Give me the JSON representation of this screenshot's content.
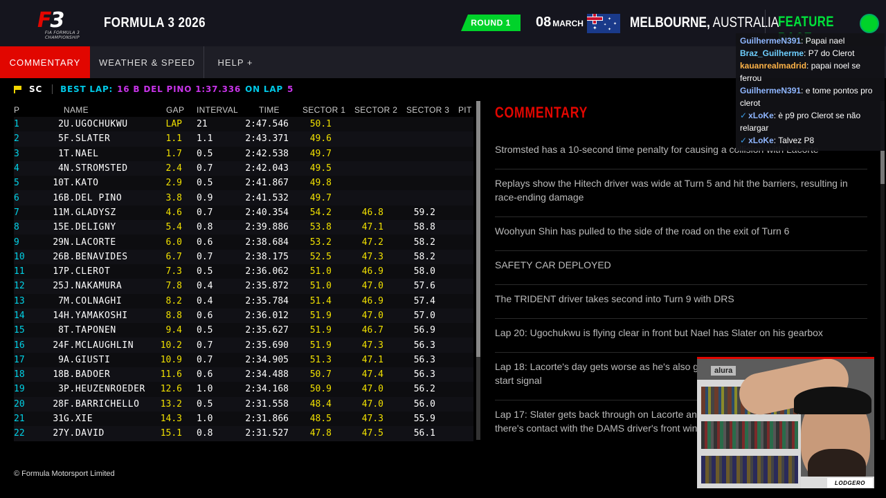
{
  "header": {
    "logo_text": "F3",
    "logo_sub": "FIA FORMULA 3 CHAMPIONSHIP",
    "title": "FORMULA 3 2026",
    "round": "ROUND 1",
    "date_day": "08",
    "date_month": "MARCH",
    "city": "MELBOURNE,",
    "country": " AUSTRALIA",
    "race_type": "FEATURE RACE",
    "flag_icon": "australia-flag-icon"
  },
  "tabs": [
    {
      "label": "COMMENTARY",
      "active": true
    },
    {
      "label": "WEATHER & SPEED",
      "active": false
    },
    {
      "label": "HELP  +",
      "active": false
    }
  ],
  "status": {
    "flag": "SC",
    "best_lap_label": "BEST LAP:",
    "best_lap_value": "16 B DEL PINO 1:37.336",
    "on_lap_label": "ON LAP",
    "on_lap_value": "5"
  },
  "table": {
    "headers": {
      "p": "P",
      "name": "NAME",
      "gap": "GAP",
      "interval": "INTERVAL",
      "time": "TIME",
      "s1": "SECTOR 1",
      "s2": "SECTOR 2",
      "s3": "SECTOR 3",
      "pit": "PIT"
    },
    "rows": [
      {
        "p": "1",
        "no": "2",
        "name": "U.UGOCHUKWU",
        "gap": "LAP",
        "int": "21",
        "time": "2:47.546",
        "s1": "50.1",
        "s2": "",
        "s3": ""
      },
      {
        "p": "2",
        "no": "5",
        "name": "F.SLATER",
        "gap": "1.1",
        "int": "1.1",
        "time": "2:43.371",
        "s1": "49.6",
        "s2": "",
        "s3": ""
      },
      {
        "p": "3",
        "no": "1",
        "name": "T.NAEL",
        "gap": "1.7",
        "int": "0.5",
        "time": "2:42.538",
        "s1": "49.7",
        "s2": "",
        "s3": ""
      },
      {
        "p": "4",
        "no": "4",
        "name": "N.STROMSTED",
        "gap": "2.4",
        "int": "0.7",
        "time": "2:42.043",
        "s1": "49.5",
        "s2": "",
        "s3": ""
      },
      {
        "p": "5",
        "no": "10",
        "name": "T.KATO",
        "gap": "2.9",
        "int": "0.5",
        "time": "2:41.867",
        "s1": "49.8",
        "s2": "",
        "s3": ""
      },
      {
        "p": "6",
        "no": "16",
        "name": "B.DEL PINO",
        "gap": "3.8",
        "int": "0.9",
        "time": "2:41.532",
        "s1": "49.7",
        "s2": "",
        "s3": ""
      },
      {
        "p": "7",
        "no": "11",
        "name": "M.GLADYSZ",
        "gap": "4.6",
        "int": "0.7",
        "time": "2:40.354",
        "s1": "54.2",
        "s2": "46.8",
        "s3": "59.2"
      },
      {
        "p": "8",
        "no": "15",
        "name": "E.DELIGNY",
        "gap": "5.4",
        "int": "0.8",
        "time": "2:39.886",
        "s1": "53.8",
        "s2": "47.1",
        "s3": "58.8"
      },
      {
        "p": "9",
        "no": "29",
        "name": "N.LACORTE",
        "gap": "6.0",
        "int": "0.6",
        "time": "2:38.684",
        "s1": "53.2",
        "s2": "47.2",
        "s3": "58.2"
      },
      {
        "p": "10",
        "no": "26",
        "name": "B.BENAVIDES",
        "gap": "6.7",
        "int": "0.7",
        "time": "2:38.175",
        "s1": "52.5",
        "s2": "47.3",
        "s3": "58.2"
      },
      {
        "p": "11",
        "no": "17",
        "name": "P.CLEROT",
        "gap": "7.3",
        "int": "0.5",
        "time": "2:36.062",
        "s1": "51.0",
        "s2": "46.9",
        "s3": "58.0"
      },
      {
        "p": "12",
        "no": "25",
        "name": "J.NAKAMURA",
        "gap": "7.8",
        "int": "0.4",
        "time": "2:35.872",
        "s1": "51.0",
        "s2": "47.0",
        "s3": "57.6"
      },
      {
        "p": "13",
        "no": "7",
        "name": "M.COLNAGHI",
        "gap": "8.2",
        "int": "0.4",
        "time": "2:35.784",
        "s1": "51.4",
        "s2": "46.9",
        "s3": "57.4"
      },
      {
        "p": "14",
        "no": "14",
        "name": "H.YAMAKOSHI",
        "gap": "8.8",
        "int": "0.6",
        "time": "2:36.012",
        "s1": "51.9",
        "s2": "47.0",
        "s3": "57.0"
      },
      {
        "p": "15",
        "no": "8",
        "name": "T.TAPONEN",
        "gap": "9.4",
        "int": "0.5",
        "time": "2:35.627",
        "s1": "51.9",
        "s2": "46.7",
        "s3": "56.9"
      },
      {
        "p": "16",
        "no": "24",
        "name": "F.MCLAUGHLIN",
        "gap": "10.2",
        "int": "0.7",
        "time": "2:35.690",
        "s1": "51.9",
        "s2": "47.3",
        "s3": "56.3"
      },
      {
        "p": "17",
        "no": "9",
        "name": "A.GIUSTI",
        "gap": "10.9",
        "int": "0.7",
        "time": "2:34.905",
        "s1": "51.3",
        "s2": "47.1",
        "s3": "56.3"
      },
      {
        "p": "18",
        "no": "18",
        "name": "B.BADOER",
        "gap": "11.6",
        "int": "0.6",
        "time": "2:34.488",
        "s1": "50.7",
        "s2": "47.4",
        "s3": "56.3"
      },
      {
        "p": "19",
        "no": "3",
        "name": "P.HEUZENROEDER",
        "gap": "12.6",
        "int": "1.0",
        "time": "2:34.168",
        "s1": "50.9",
        "s2": "47.0",
        "s3": "56.2"
      },
      {
        "p": "20",
        "no": "28",
        "name": "F.BARRICHELLO",
        "gap": "13.2",
        "int": "0.5",
        "time": "2:31.558",
        "s1": "48.4",
        "s2": "47.0",
        "s3": "56.0"
      },
      {
        "p": "21",
        "no": "31",
        "name": "G.XIE",
        "gap": "14.3",
        "int": "1.0",
        "time": "2:31.866",
        "s1": "48.5",
        "s2": "47.3",
        "s3": "55.9"
      },
      {
        "p": "22",
        "no": "27",
        "name": "Y.DAVID",
        "gap": "15.1",
        "int": "0.8",
        "time": "2:31.527",
        "s1": "47.8",
        "s2": "47.5",
        "s3": "56.1"
      }
    ]
  },
  "commentary": {
    "title": "COMMENTARY",
    "items": [
      "Stromsted has a 10-second time penalty for causing a collision with Lacorte",
      "Replays show the Hitech driver was wide at Turn 5 and hit the barriers, resulting in race-ending damage",
      "Woohyun Shin has pulled to the side of the road on the exit of Turn 6",
      "SAFETY CAR DEPLOYED",
      "The TRIDENT driver takes second into Turn 9 with DRS",
      "Lap 20: Ugochukwu is flying clear in front but Nael has Slater on his gearbox",
      "Lap 18: Lacorte's day gets worse as he's also given a penalty for moving before the start signal",
      "Lap 17: Slater gets back through on Lacorte and gets the position at Turn 12 but there's contact with the DAMS driver's front wing endplate"
    ]
  },
  "footer": "© Formula Motorsport Limited",
  "chat": [
    {
      "user": "GuilhermeN391",
      "color": "#8fb6ff",
      "text": ": Papai nael",
      "badge": ""
    },
    {
      "user": "Braz_Guilherme",
      "color": "#6ecfff",
      "text": ": P7 do Clerot",
      "badge": ""
    },
    {
      "user": "kauanrealmadrid",
      "color": "#ffb347",
      "text": ": papai noel se ferrou",
      "badge": ""
    },
    {
      "user": "GuilhermeN391",
      "color": "#8fb6ff",
      "text": ": e tome pontos pro clerot",
      "badge": ""
    },
    {
      "user": "xLoKe",
      "color": "#8fb6ff",
      "text": ": è p9 pro Clerot se não relargar",
      "badge": "✓"
    },
    {
      "user": "xLoKe",
      "color": "#8fb6ff",
      "text": ": Talvez P8",
      "badge": "✓"
    }
  ],
  "webcam": {
    "sign": "alura",
    "logo": "LODGERO"
  }
}
